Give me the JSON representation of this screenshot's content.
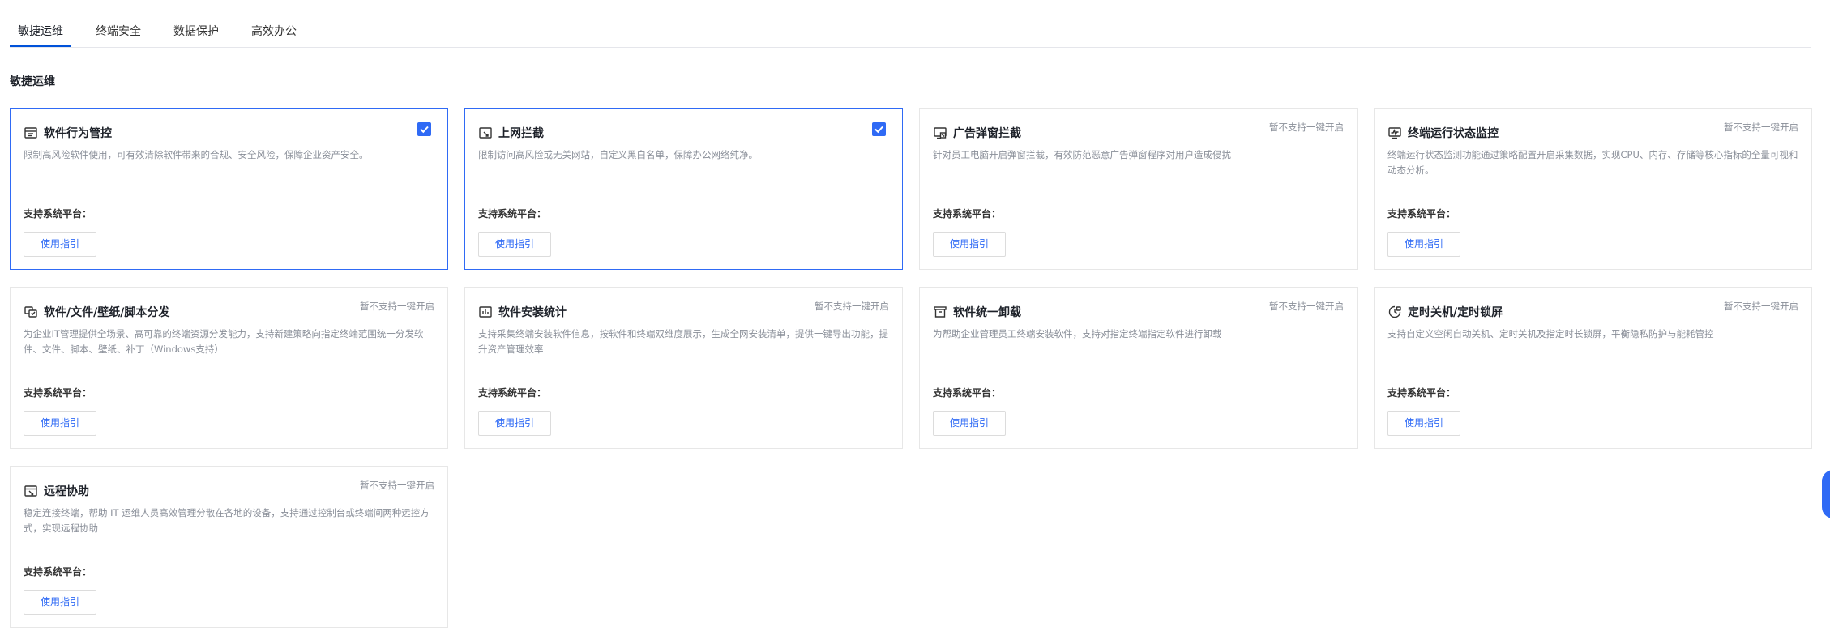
{
  "tabs": [
    {
      "label": "敏捷运维",
      "active": true
    },
    {
      "label": "终端安全",
      "active": false
    },
    {
      "label": "数据保护",
      "active": false
    },
    {
      "label": "高效办公",
      "active": false
    }
  ],
  "section_title": "敏捷运维",
  "common": {
    "platform_label": "支持系统平台：",
    "guide_label": "使用指引",
    "not_supported_label": "暂不支持一键开启"
  },
  "colors": {
    "accent": "#2f6af5",
    "border": "#e7e7e7",
    "muted_text": "#8a8f99"
  },
  "cards": [
    {
      "title": "软件行为管控",
      "icon": "app-window-icon",
      "checked": true,
      "description": "限制高风险软件使用，可有效清除软件带来的合规、安全风险，保障企业资产安全。"
    },
    {
      "title": "上网拦截",
      "icon": "web-block-icon",
      "checked": true,
      "description": "限制访问高风险或无关网站，自定义黑白名单，保障办公网络纯净。"
    },
    {
      "title": "广告弹窗拦截",
      "icon": "popup-block-icon",
      "checked": false,
      "description": "针对员工电脑开启弹窗拦截，有效防范恶意广告弹窗程序对用户造成侵扰"
    },
    {
      "title": "终端运行状态监控",
      "icon": "monitor-icon",
      "checked": false,
      "description": "终端运行状态监测功能通过策略配置开启采集数据，实现CPU、内存、存储等核心指标的全量可视和动态分析。"
    },
    {
      "title": "软件/文件/壁纸/脚本分发",
      "icon": "distribute-icon",
      "checked": false,
      "description": "为企业IT管理提供全场景、高可靠的终端资源分发能力，支持新建策略向指定终端范围统一分发软件、文件、脚本、壁纸、补丁（Windows支持）"
    },
    {
      "title": "软件安装统计",
      "icon": "stats-icon",
      "checked": false,
      "description": "支持采集终端安装软件信息，按软件和终端双维度展示，生成全网安装清单，提供一键导出功能，提升资产管理效率"
    },
    {
      "title": "软件统一卸载",
      "icon": "uninstall-icon",
      "checked": false,
      "description": "为帮助企业管理员工终端安装软件，支持对指定终端指定软件进行卸载"
    },
    {
      "title": "定时关机/定时锁屏",
      "icon": "timer-lock-icon",
      "checked": false,
      "description": "支持自定义空闲自动关机、定时关机及指定时长锁屏，平衡隐私防护与能耗管控"
    },
    {
      "title": "远程协助",
      "icon": "remote-assist-icon",
      "checked": false,
      "description": "稳定连接终端，帮助 IT 运维人员高效管理分散在各地的设备，支持通过控制台或终端间两种远控方式，实现远程协助"
    }
  ]
}
